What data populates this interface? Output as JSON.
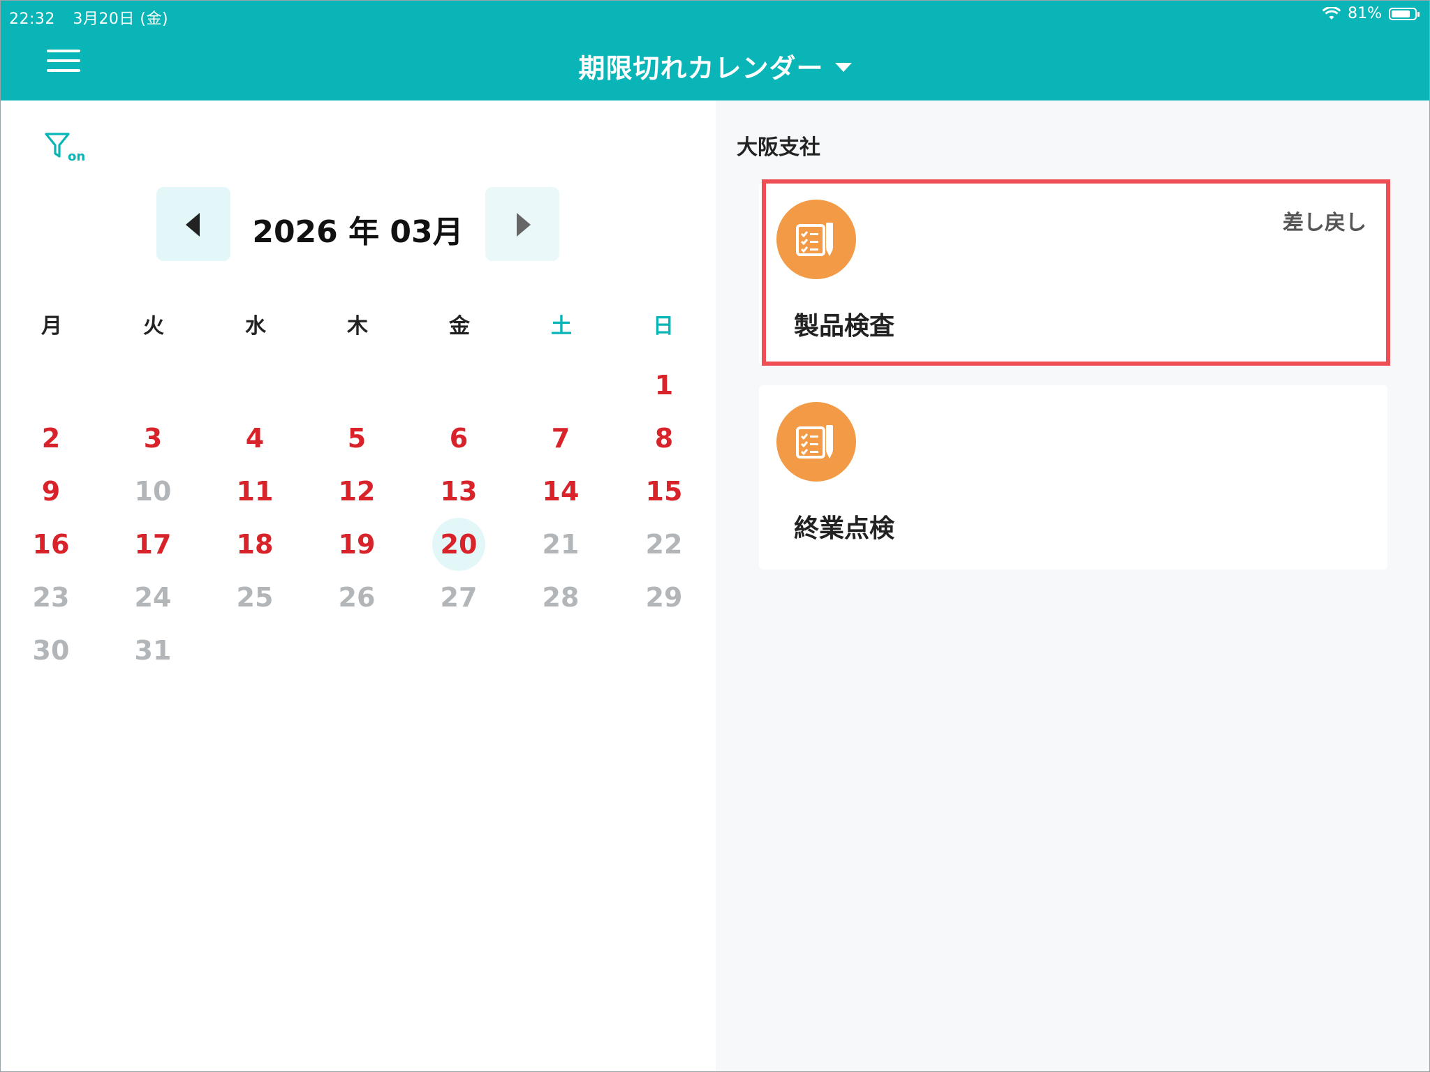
{
  "status_bar": {
    "time": "22:32",
    "date": "3月20日 (金)",
    "battery": "81%",
    "battery_level": 0.81
  },
  "header": {
    "title": "期限切れカレンダー"
  },
  "filter": {
    "badge": "on"
  },
  "calendar": {
    "month_label": "2026 年 03月",
    "weekdays": [
      "月",
      "火",
      "水",
      "木",
      "金",
      "土",
      "日"
    ],
    "days": [
      "1",
      "2",
      "3",
      "4",
      "5",
      "6",
      "7",
      "8",
      "9",
      "10",
      "11",
      "12",
      "13",
      "14",
      "15",
      "16",
      "17",
      "18",
      "19",
      "20",
      "21",
      "22",
      "23",
      "24",
      "25",
      "26",
      "27",
      "28",
      "29",
      "30",
      "31"
    ]
  },
  "right": {
    "branch": "大阪支社",
    "cards": [
      {
        "title": "製品検査",
        "status": "差し戻し"
      },
      {
        "title": "終業点検",
        "status": ""
      }
    ]
  },
  "colors": {
    "accent": "#0ab5b8",
    "red": "#d8232a",
    "gray": "#b3b6b8",
    "orange": "#f29a45",
    "highlight": "#ef4e55"
  }
}
